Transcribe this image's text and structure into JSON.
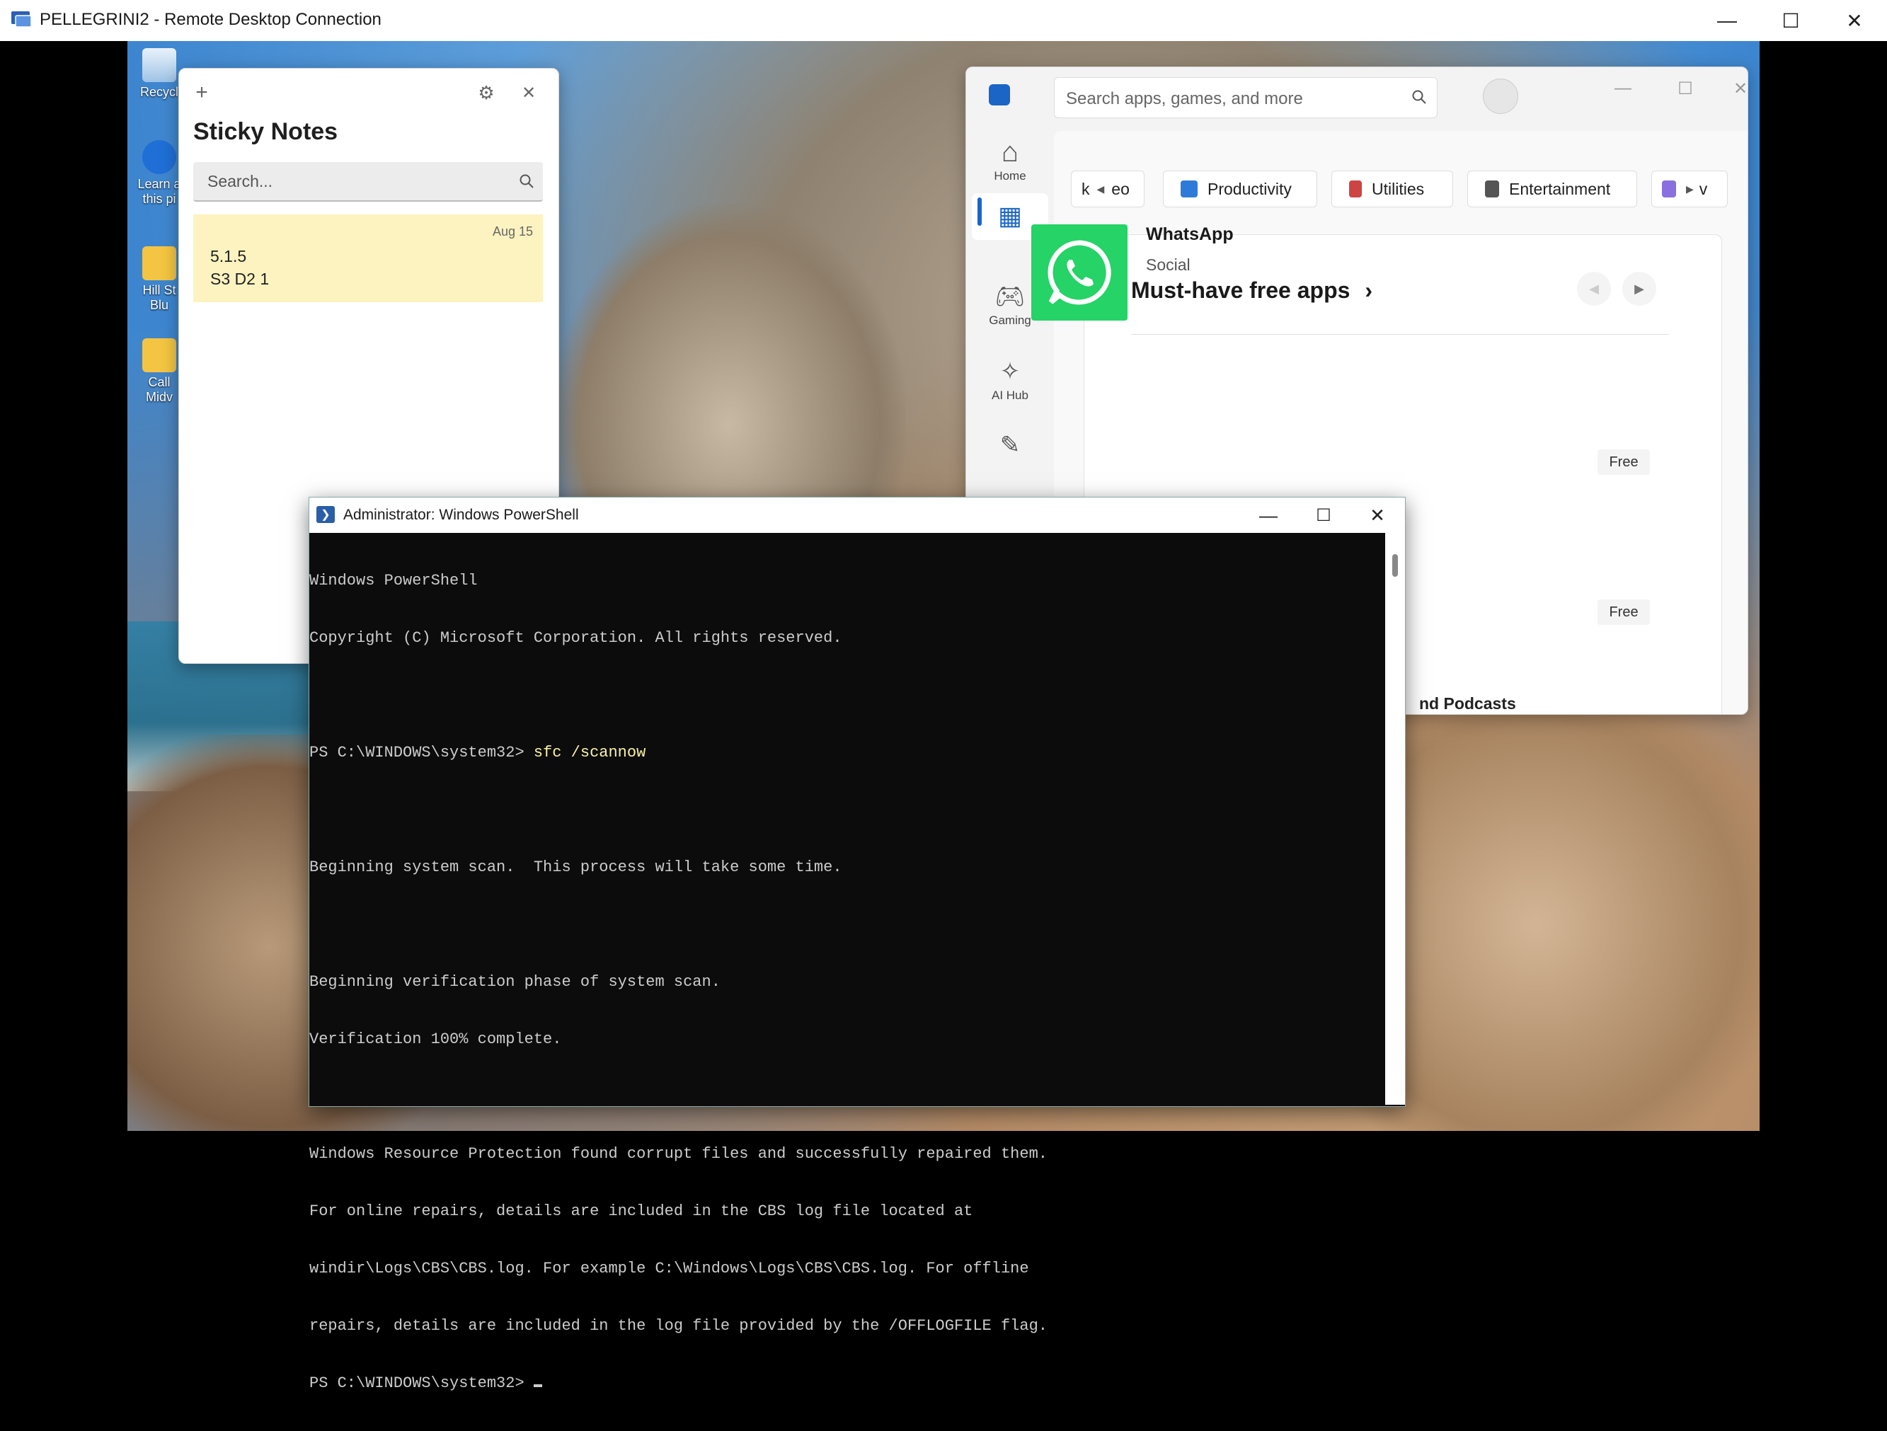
{
  "rdp": {
    "title": "PELLEGRINI2 - Remote Desktop Connection",
    "minimize": "—",
    "maximize": "☐",
    "close": "✕"
  },
  "desktop_icons": [
    {
      "label": "Recycl",
      "icon": "recycle-bin-icon"
    },
    {
      "label": "Learn a this pi",
      "icon": "info-icon"
    },
    {
      "label": "Hill St Blu",
      "icon": "folder-shortcut-icon"
    },
    {
      "label": "Call Midv",
      "icon": "folder-shortcut-icon"
    }
  ],
  "sticky": {
    "add": "+",
    "settings": "⚙",
    "close": "✕",
    "title": "Sticky Notes",
    "search_placeholder": "Search...",
    "note": {
      "date": "Aug 15",
      "line1": "5.1.5",
      "line2": "S3 D2 1"
    }
  },
  "store": {
    "search_placeholder": "Search apps, games, and more",
    "nav": [
      {
        "label": "Home",
        "icon": "home-icon"
      },
      {
        "label": "",
        "icon": "apps-icon"
      },
      {
        "label": "Gaming",
        "icon": "gamepad-icon"
      },
      {
        "label": "AI Hub",
        "icon": "sparkle-icon"
      },
      {
        "label": "",
        "icon": "brush-icon"
      }
    ],
    "pills": [
      {
        "label": "eo",
        "prefix": "k"
      },
      {
        "label": "Productivity"
      },
      {
        "label": "Utilities"
      },
      {
        "label": "Entertainment"
      },
      {
        "label": "v"
      }
    ],
    "section_title": "Must-have free apps",
    "section_chevron": "›",
    "apps": [
      {
        "name": "WhatsApp",
        "category": "Social",
        "price": "Free"
      },
      {
        "name": "",
        "category": "",
        "price": "Free"
      }
    ],
    "podcasts_fragment": "nd Podcasts"
  },
  "powershell": {
    "title": "Administrator: Windows PowerShell",
    "lines": [
      "Windows PowerShell",
      "Copyright (C) Microsoft Corporation. All rights reserved.",
      "",
      "",
      "",
      "Beginning system scan.  This process will take some time.",
      "",
      "Beginning verification phase of system scan.",
      "Verification 100% complete.",
      "",
      "Windows Resource Protection found corrupt files and successfully repaired them.",
      "For online repairs, details are included in the CBS log file located at",
      "windir\\Logs\\CBS\\CBS.log. For example C:\\Windows\\Logs\\CBS\\CBS.log. For offline",
      "repairs, details are included in the log file provided by the /OFFLOGFILE flag."
    ],
    "prompt": "PS C:\\WINDOWS\\system32> ",
    "command": "sfc /scannow",
    "final_prompt": "PS C:\\WINDOWS\\system32> "
  },
  "colors": {
    "accent": "#1b65c7",
    "whatsapp": "#25d366",
    "note": "#fdf3c0"
  }
}
